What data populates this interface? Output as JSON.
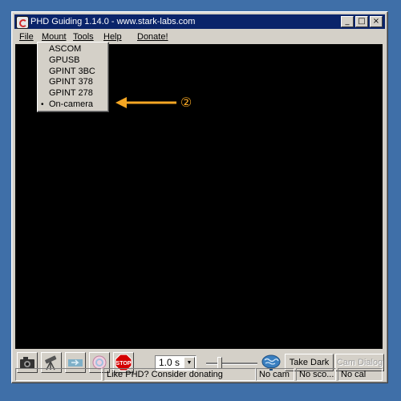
{
  "window": {
    "title": "PHD Guiding 1.14.0  -  www.stark-labs.com",
    "controls": [
      "_",
      "□",
      "×"
    ]
  },
  "menubar": {
    "items": [
      {
        "label": "File"
      },
      {
        "label": "Mount"
      },
      {
        "label": "Tools"
      },
      {
        "label": "Help"
      },
      {
        "label": "Donate!"
      }
    ]
  },
  "mount_menu": {
    "items": [
      {
        "label": "ASCOM"
      },
      {
        "label": "GPUSB"
      },
      {
        "label": "GPINT 3BC"
      },
      {
        "label": "GPINT 378"
      },
      {
        "label": "GPINT 278"
      },
      {
        "label": "On-camera",
        "selected": true
      }
    ],
    "selected_marker": "•"
  },
  "annotation": {
    "label": "②",
    "color": "#f5a623"
  },
  "toolbar": {
    "icons": [
      {
        "name": "camera-icon"
      },
      {
        "name": "telescope-icon"
      },
      {
        "name": "loop-icon"
      },
      {
        "name": "guide-icon"
      },
      {
        "name": "stop-icon",
        "label": "STOP"
      }
    ],
    "exposure": "1.0 s",
    "take_dark": "Take Dark",
    "cam_dialog": "Cam Dialog"
  },
  "statusbar": {
    "message": "Like PHD? Consider donating",
    "cam": "No cam",
    "scope": "No sco...",
    "cal": "No cal"
  }
}
